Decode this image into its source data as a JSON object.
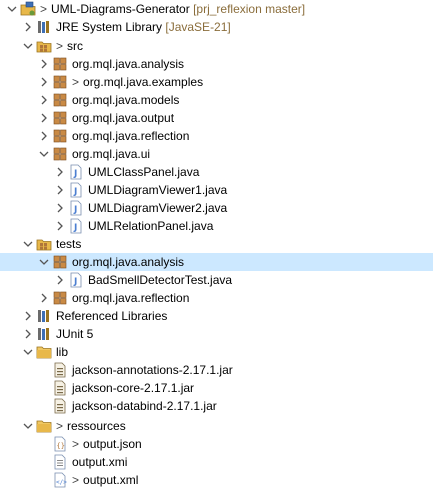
{
  "project": {
    "prefix": ">",
    "name": "UML-Diagrams-Generator",
    "repo": "[prj_reflexion master]"
  },
  "jre": {
    "label": "JRE System Library",
    "version": "[JavaSE-21]"
  },
  "src": {
    "label": "src",
    "packages": [
      "org.mql.java.analysis",
      "org.mql.java.examples",
      "org.mql.java.models",
      "org.mql.java.output",
      "org.mql.java.reflection",
      "org.mql.java.ui"
    ],
    "ui_files": [
      "UMLClassPanel.java",
      "UMLDiagramViewer1.java",
      "UMLDiagramViewer2.java",
      "UMLRelationPanel.java"
    ]
  },
  "tests": {
    "label": "tests",
    "packages": [
      "org.mql.java.analysis",
      "org.mql.java.reflection"
    ],
    "analysis_files": [
      "BadSmellDetectorTest.java"
    ]
  },
  "referenced_libraries": "Referenced Libraries",
  "junit": "JUnit 5",
  "lib": {
    "label": "lib",
    "jars": [
      "jackson-annotations-2.17.1.jar",
      "jackson-core-2.17.1.jar",
      "jackson-databind-2.17.1.jar"
    ]
  },
  "ressources": {
    "label": "ressources",
    "files": [
      "output.json",
      "output.xmi",
      "output.xml"
    ]
  },
  "decorations": {
    "changed_marker": ">"
  },
  "colors": {
    "selection": "#cce8ff",
    "folder": "#e8b84a",
    "package": "#b0763a",
    "java": "#4c7fd1",
    "jar": "#7a6a4a",
    "repo_text": "#8a6d3b"
  }
}
